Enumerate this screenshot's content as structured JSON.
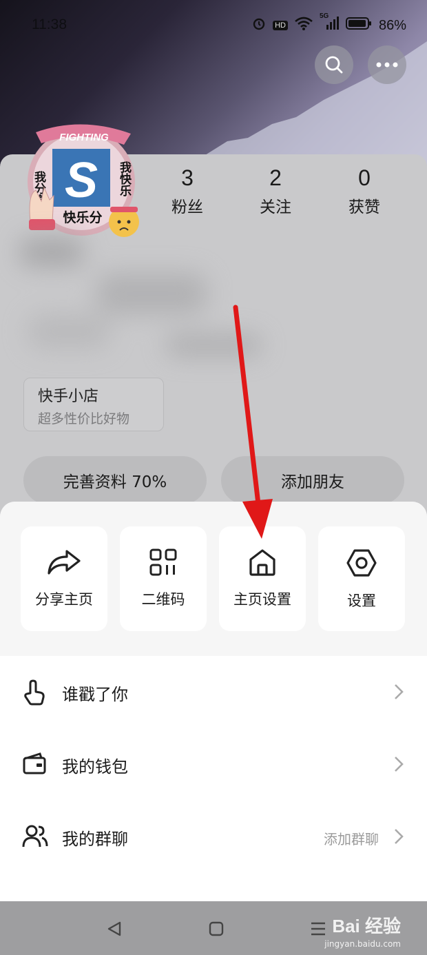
{
  "status": {
    "time": "11:38",
    "battery": "86%",
    "network": "5G",
    "hd": "HD"
  },
  "profile": {
    "stats": [
      {
        "num": "3",
        "label": "粉丝"
      },
      {
        "num": "2",
        "label": "关注"
      },
      {
        "num": "0",
        "label": "获赞"
      }
    ],
    "avatar_text": {
      "left": "我分享",
      "center": "快乐分",
      "right": "我快乐",
      "banner": "FIGHTING",
      "logo": "S"
    },
    "shop": {
      "title": "快手小店",
      "subtitle": "超多性价比好物"
    },
    "complete_profile": "完善资料 70%",
    "add_friend": "添加朋友"
  },
  "actions": [
    {
      "label": "分享主页",
      "icon": "share-arrow-icon"
    },
    {
      "label": "二维码",
      "icon": "qr-code-icon"
    },
    {
      "label": "主页设置",
      "icon": "home-icon"
    },
    {
      "label": "设置",
      "icon": "hexagon-settings-icon"
    }
  ],
  "menu": [
    {
      "label": "谁戳了你",
      "icon": "tap-hand-icon"
    },
    {
      "label": "我的钱包",
      "icon": "wallet-icon"
    },
    {
      "label": "我的群聊",
      "icon": "group-users-icon",
      "sub": "添加群聊"
    }
  ],
  "watermark": {
    "brand": "Bai 经验",
    "url": "jingyan.baidu.com"
  },
  "colors": {
    "arrow": "#e01818",
    "sheet_bg": "#f6f6f6"
  }
}
